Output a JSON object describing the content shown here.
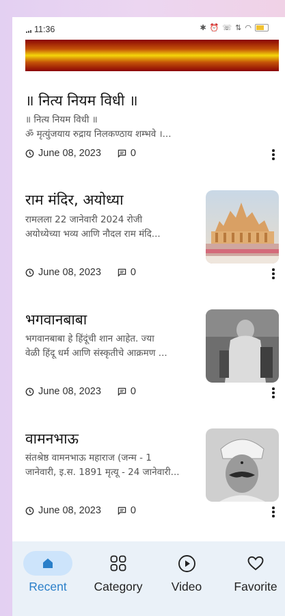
{
  "status": {
    "time": "11:36"
  },
  "posts": [
    {
      "title": "॥ नित्य नियम विधी ॥",
      "excerpt_lines": [
        "॥ नित्य नियम विधी ॥",
        "ॐ मृत्युंजयाय रुद्राय निलकण्ठाय शम्भवे ।..."
      ],
      "date": "June 08, 2023",
      "comments": "0",
      "has_image": false
    },
    {
      "title": "राम मंदिर, अयोध्या",
      "excerpt_lines": [
        "रामलला 22 जानेवारी 2024 रोजी",
        "अयोध्येच्या भव्य आणि नौदल राम मंदि..."
      ],
      "date": "June 08, 2023",
      "comments": "0",
      "has_image": true,
      "image": "ram-mandir-photo"
    },
    {
      "title": "भगवानबाबा",
      "excerpt_lines": [
        "भगवानबाबा हे हिंदूंची शान आहेत. ज्या",
        "वेळी हिंदू धर्म आणि संस्कृतीचे आक्रमण ..."
      ],
      "date": "June 08, 2023",
      "comments": "0",
      "has_image": true,
      "image": "bhagwanbaba-photo"
    },
    {
      "title": "वामनभाऊ",
      "excerpt_lines": [
        "संतश्रेष्ठ वामनभाऊ महाराज (जन्म - 1",
        "जानेवारी, इ.स. 1891 मृत्यू - 24 जानेवारी..."
      ],
      "date": "June 08, 2023",
      "comments": "0",
      "has_image": true,
      "image": "vamanbhau-photo"
    }
  ],
  "nav": {
    "items": [
      {
        "label": "Recent",
        "icon": "home-icon",
        "active": true
      },
      {
        "label": "Category",
        "icon": "grid-icon",
        "active": false
      },
      {
        "label": "Video",
        "icon": "play-circle-icon",
        "active": false
      },
      {
        "label": "Favorite",
        "icon": "heart-icon",
        "active": false
      }
    ]
  },
  "colors": {
    "accent": "#2a7fc9",
    "nav_bg": "#eaf1f8",
    "active_pill": "#cde4fb"
  }
}
